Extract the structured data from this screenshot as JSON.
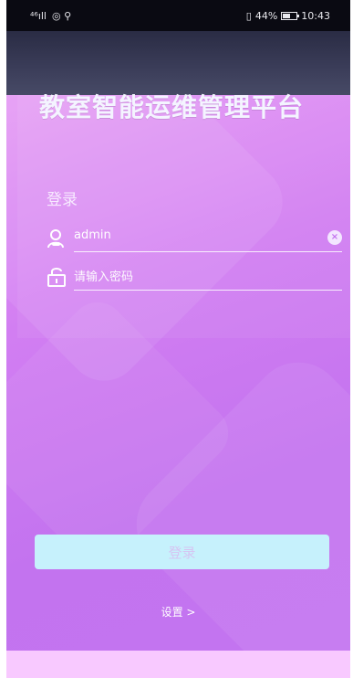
{
  "status_bar": {
    "signal": "⁴⁶ıll",
    "icons_left": "◎ ⚲",
    "battery": "44%",
    "time": "10:43"
  },
  "app": {
    "title": "教室智能运维管理平台"
  },
  "login": {
    "heading": "登录",
    "username_value": "admin",
    "password_placeholder": "请输入密码",
    "login_button": "登录",
    "settings_link": "设置 >"
  },
  "colors": {
    "accent": "#c373ef",
    "button_bg": "#c6f1fc",
    "title_accent": "#7fd6f4"
  },
  "icons": {
    "user": "user-icon",
    "lock": "lock-icon",
    "clear": "clear-icon"
  }
}
